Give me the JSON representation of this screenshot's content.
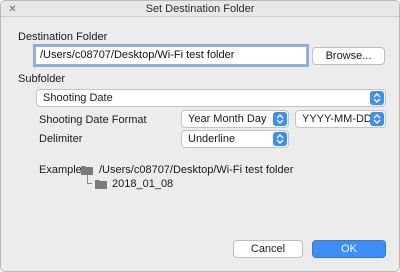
{
  "window": {
    "title": "Set Destination Folder"
  },
  "destination": {
    "label": "Destination Folder",
    "path": "/Users/c08707/Desktop/Wi-Fi test folder",
    "browse_label": "Browse..."
  },
  "subfolder": {
    "label": "Subfolder",
    "selected": "Shooting Date",
    "date_format_label": "Shooting Date Format",
    "date_format_selected": "Year Month Day",
    "date_pattern_selected": "YYYY-MM-DD",
    "delimiter_label": "Delimiter",
    "delimiter_selected": "Underline"
  },
  "example": {
    "label": "Example:",
    "root_path": "/Users/c08707/Desktop/Wi-Fi test folder",
    "child_folder": "2018_01_08"
  },
  "footer": {
    "cancel_label": "Cancel",
    "ok_label": "OK"
  },
  "colors": {
    "accent": "#3d8ff5",
    "focus_ring": "#7fb1ec",
    "background": "#ececec"
  },
  "icons": [
    "close-icon",
    "folder-icon",
    "up-down-chevron-icon"
  ]
}
